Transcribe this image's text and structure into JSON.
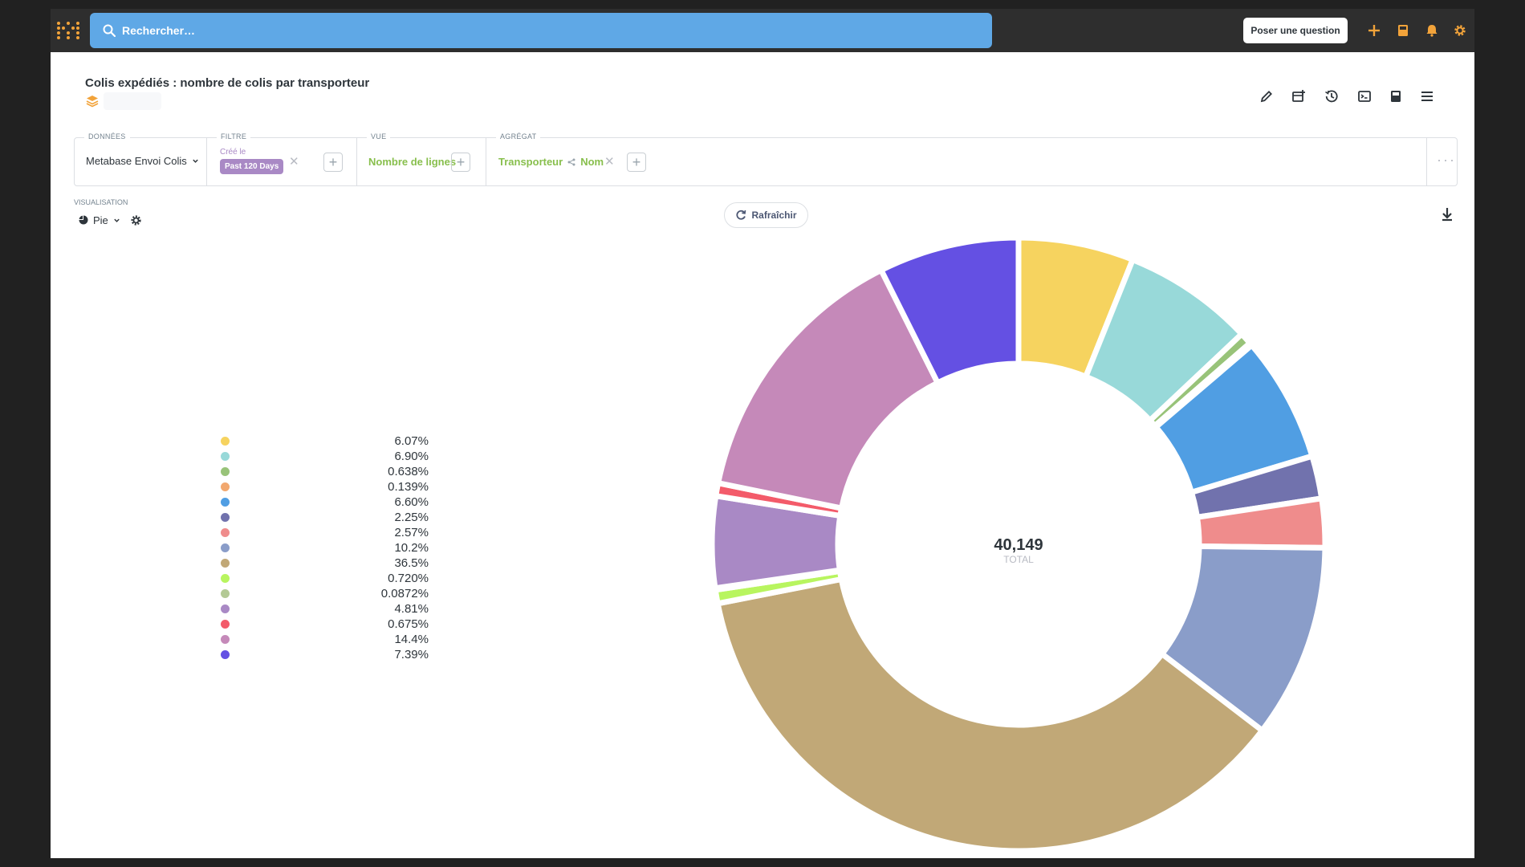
{
  "topnav": {
    "search_placeholder": "Rechercher…",
    "ask_button": "Poser une question",
    "accent": "#f2a33a",
    "search_color": "#5fa8e6",
    "icons": [
      "plus-icon",
      "notebook-icon",
      "bell-icon",
      "gear-icon"
    ]
  },
  "header": {
    "title": "Colis expédiés : nombre de colis par transporteur",
    "icons": [
      "pencil-icon",
      "add-to-dashboard-icon",
      "history-icon",
      "sql-icon",
      "bookmark-icon",
      "menu-icon"
    ]
  },
  "query": {
    "data": {
      "label": "DONNÉES",
      "value": "Metabase Envoi Colis"
    },
    "filter": {
      "label": "FILTRE",
      "field": "Créé le",
      "value": "Past 120 Days"
    },
    "view": {
      "label": "VUE",
      "value": "Nombre de lignes"
    },
    "aggregate": {
      "label": "AGRÉGAT",
      "dimension": "Transporteur",
      "subfield": "Nom"
    },
    "more": "···"
  },
  "visualization": {
    "label": "VISUALISATION",
    "type": "Pie",
    "refresh": "Rafraîchir"
  },
  "chart_data": {
    "type": "pie",
    "donut": true,
    "total": "40,149",
    "total_label": "TOTAL",
    "slices": [
      {
        "name": "",
        "pct_label": "6.07%",
        "value": 6.07,
        "color": "#f6d35f"
      },
      {
        "name": "",
        "pct_label": "6.90%",
        "value": 6.9,
        "color": "#98d9d9"
      },
      {
        "name": "",
        "pct_label": "0.638%",
        "value": 0.638,
        "color": "#98c379"
      },
      {
        "name": "",
        "pct_label": "0.139%",
        "value": 0.139,
        "color": "#f2a86f"
      },
      {
        "name": "",
        "pct_label": "6.60%",
        "value": 6.6,
        "color": "#509ee3"
      },
      {
        "name": "",
        "pct_label": "2.25%",
        "value": 2.25,
        "color": "#7172ad"
      },
      {
        "name": "",
        "pct_label": "2.57%",
        "value": 2.57,
        "color": "#ef8c8c"
      },
      {
        "name": "",
        "pct_label": "10.2%",
        "value": 10.2,
        "color": "#8a9dc9"
      },
      {
        "name": "",
        "pct_label": "36.5%",
        "value": 36.5,
        "color": "#c1a877"
      },
      {
        "name": "",
        "pct_label": "0.720%",
        "value": 0.72,
        "color": "#b8f55f"
      },
      {
        "name": "",
        "pct_label": "0.0872%",
        "value": 0.0872,
        "color": "#b3c995"
      },
      {
        "name": "",
        "pct_label": "4.81%",
        "value": 4.81,
        "color": "#a989c5"
      },
      {
        "name": "",
        "pct_label": "0.675%",
        "value": 0.675,
        "color": "#f35b6a"
      },
      {
        "name": "",
        "pct_label": "14.4%",
        "value": 14.4,
        "color": "#c589b9"
      },
      {
        "name": "",
        "pct_label": "7.39%",
        "value": 7.39,
        "color": "#6450e3"
      }
    ]
  }
}
